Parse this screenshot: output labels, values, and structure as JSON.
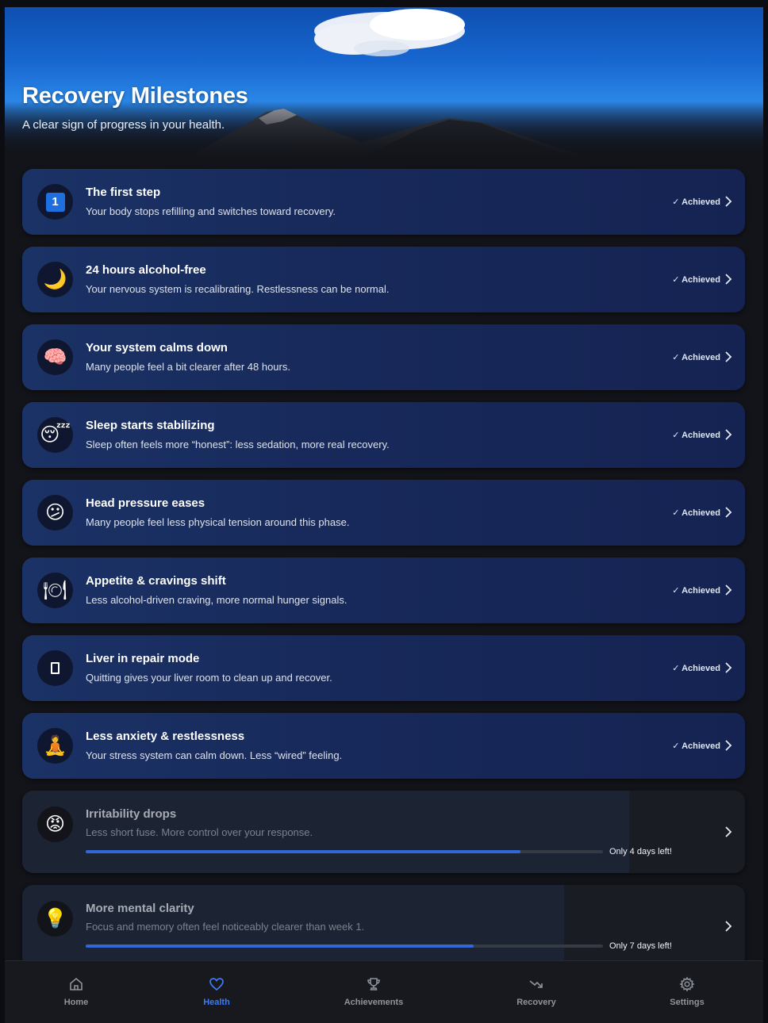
{
  "hero": {
    "title": "Recovery Milestones",
    "subtitle": "A clear sign of progress in your health."
  },
  "milestones": [
    {
      "icon": "keycap-one-icon",
      "glyph": "1",
      "title": "The first step",
      "description": "Your body stops refilling and switches toward recovery.",
      "status": "✓ Achieved"
    },
    {
      "icon": "crescent-moon-icon",
      "glyph": "🌙",
      "title": "24 hours alcohol-free",
      "description": "Your nervous system is recalibrating. Restlessness can be normal.",
      "status": "✓ Achieved"
    },
    {
      "icon": "brain-icon",
      "glyph": "🧠",
      "title": "Your system calms down",
      "description": "Many people feel a bit clearer after 48 hours.",
      "status": "✓ Achieved"
    },
    {
      "icon": "sleeping-face-icon",
      "glyph": "😴",
      "title": "Sleep starts stabilizing",
      "description": "Sleep often feels more “honest”: less sedation, more real recovery.",
      "status": "✓ Achieved"
    },
    {
      "icon": "worried-face-icon",
      "glyph": "😕",
      "title": "Head pressure eases",
      "description": "Many people feel less physical tension around this phase.",
      "status": "✓ Achieved"
    },
    {
      "icon": "plate-cutlery-icon",
      "glyph": "🍽",
      "title": "Appetite & cravings shift",
      "description": "Less alcohol-driven craving, more normal hunger signals.",
      "status": "✓ Achieved"
    },
    {
      "icon": "liver-icon",
      "glyph": "▯",
      "title": "Liver in repair mode",
      "description": "Quitting gives your liver room to clean up and recover.",
      "status": "✓ Achieved"
    },
    {
      "icon": "meditation-icon",
      "glyph": "🧘",
      "title": "Less anxiety & restlessness",
      "description": "Your stress system can calm down. Less “wired” feeling.",
      "status": "✓ Achieved"
    }
  ],
  "upcoming": [
    {
      "icon": "angry-face-icon",
      "glyph": "😡",
      "title": "Irritability drops",
      "description": "Less short fuse. More control over your response.",
      "progress": 0.84,
      "remaining": "Only 4 days left!"
    },
    {
      "icon": "light-bulb-icon",
      "glyph": "💡",
      "title": "More mental clarity",
      "description": "Focus and memory often feel noticeably clearer than week 1.",
      "progress": 0.75,
      "remaining": "Only 7 days left!"
    }
  ],
  "nav": [
    {
      "key": "home",
      "label": "Home",
      "active": false
    },
    {
      "key": "health",
      "label": "Health",
      "active": true
    },
    {
      "key": "achievements",
      "label": "Achievements",
      "active": false
    },
    {
      "key": "recovery",
      "label": "Recovery",
      "active": false
    },
    {
      "key": "settings",
      "label": "Settings",
      "active": false
    }
  ],
  "colors": {
    "accent": "#3d7cf0",
    "progress_fill": "#3068d8",
    "card_achieved": "#17295a"
  }
}
